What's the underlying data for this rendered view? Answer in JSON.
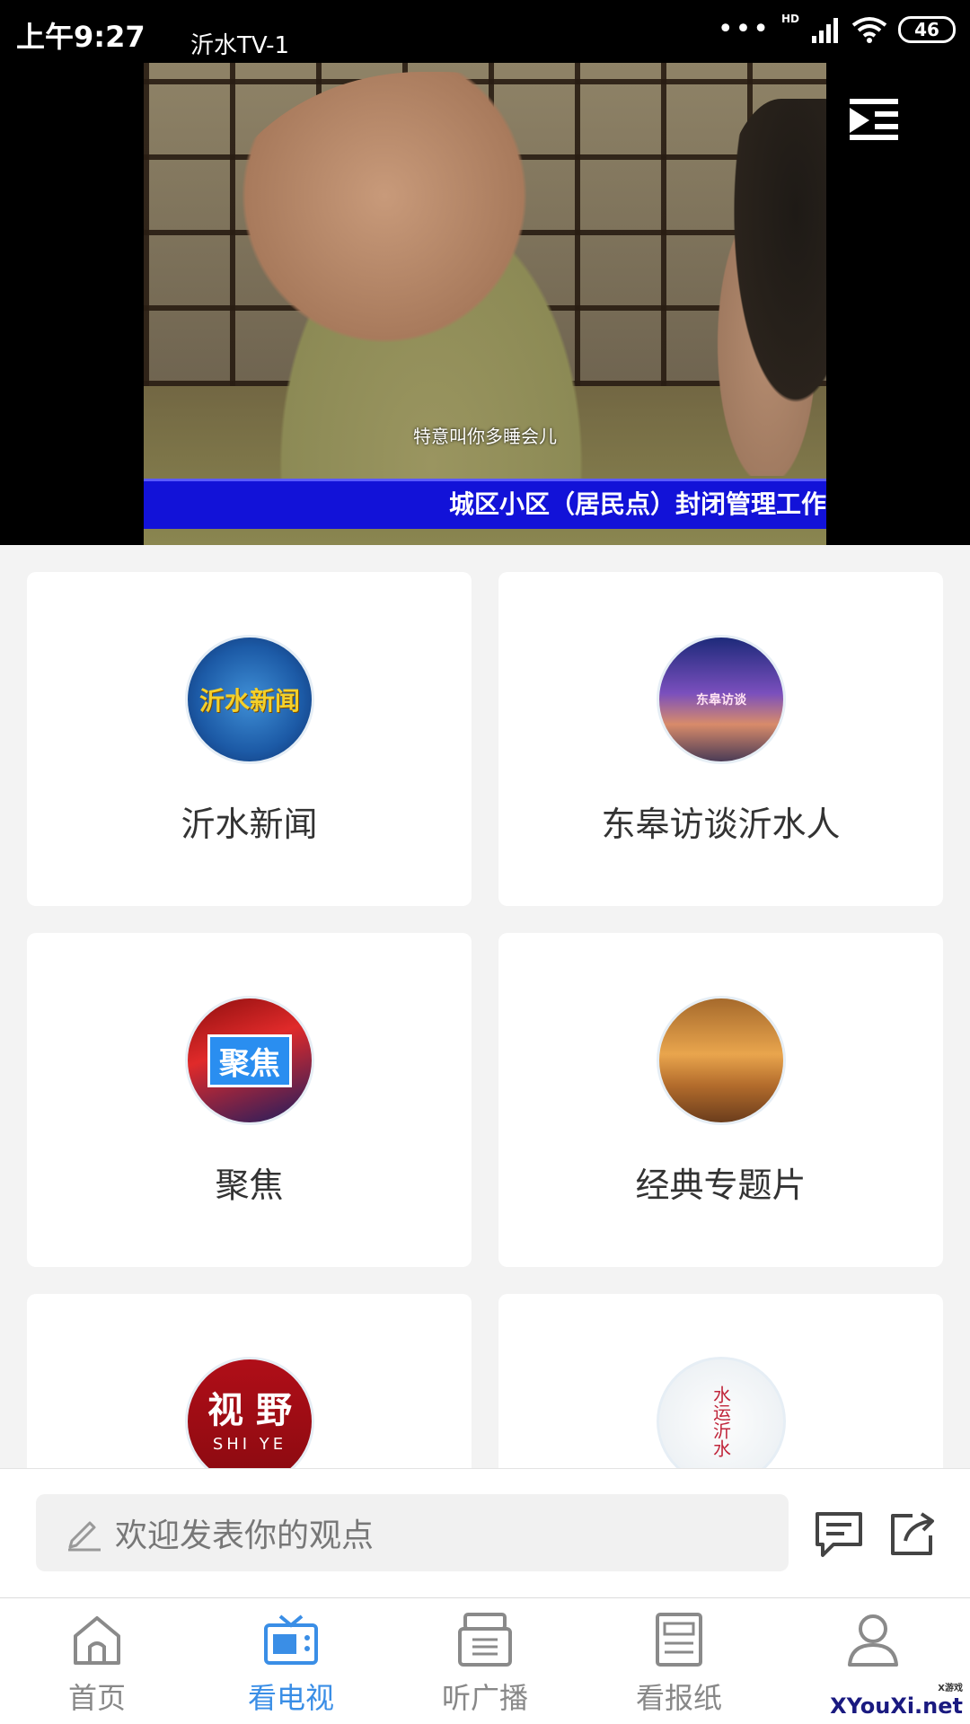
{
  "status_bar": {
    "time": "上午9:27",
    "network": "HD",
    "battery": "46"
  },
  "player": {
    "channel_title": "沂水TV-1",
    "subtitle": "特意叫你多睡会儿",
    "ticker": "城区小区（居民点）封闭管理工作"
  },
  "programs": [
    {
      "label": "沂水新闻",
      "logo_text": "沂水新闻"
    },
    {
      "label": "东皋访谈沂水人",
      "logo_text": "东皋访谈"
    },
    {
      "label": "聚焦",
      "logo_text": "聚焦"
    },
    {
      "label": "经典专题片",
      "logo_text": ""
    },
    {
      "label": "",
      "logo_text": "视 野",
      "logo_sub": "SHI YE"
    },
    {
      "label": "",
      "logo_text": "水运沂水"
    }
  ],
  "comment": {
    "placeholder": "欢迎发表你的观点"
  },
  "tabs": [
    {
      "label": "首页",
      "icon": "home-icon"
    },
    {
      "label": "看电视",
      "icon": "tv-icon",
      "active": true
    },
    {
      "label": "听广播",
      "icon": "radio-icon"
    },
    {
      "label": "看报纸",
      "icon": "newspaper-icon"
    },
    {
      "label": "",
      "icon": "profile-icon"
    }
  ],
  "watermark": {
    "text": "XYouXi.net",
    "small": "X游戏"
  },
  "colors": {
    "accent": "#3a8ee6",
    "ticker_bg": "#1212d8"
  }
}
